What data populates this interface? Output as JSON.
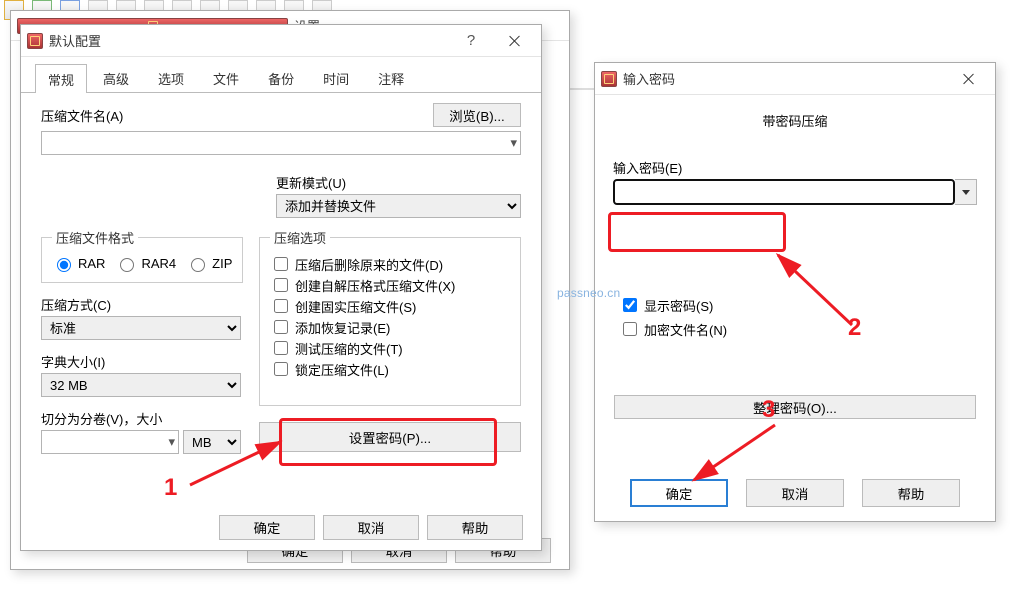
{
  "watermark": "passneo.cn",
  "parent_window": {
    "title": "设置"
  },
  "dialog1": {
    "title": "默认配置",
    "tabs": [
      "常规",
      "高级",
      "选项",
      "文件",
      "备份",
      "时间",
      "注释"
    ],
    "active_tab": 0,
    "archive_name_label": "压缩文件名(A)",
    "browse_btn": "浏览(B)...",
    "update_mode_label": "更新模式(U)",
    "update_mode_value": "添加并替换文件",
    "format_legend": "压缩文件格式",
    "formats": {
      "rar": "RAR",
      "rar4": "RAR4",
      "zip": "ZIP"
    },
    "method_label": "压缩方式(C)",
    "method_value": "标准",
    "dict_label": "字典大小(I)",
    "dict_value": "32 MB",
    "split_label": "切分为分卷(V)，大小",
    "split_unit": "MB",
    "options_legend": "压缩选项",
    "options": [
      "压缩后删除原来的文件(D)",
      "创建自解压格式压缩文件(X)",
      "创建固实压缩文件(S)",
      "添加恢复记录(E)",
      "测试压缩的文件(T)",
      "锁定压缩文件(L)"
    ],
    "set_password_btn": "设置密码(P)...",
    "footer": {
      "ok": "确定",
      "cancel": "取消",
      "help": "帮助"
    }
  },
  "dialog2": {
    "title": "输入密码",
    "subtitle": "带密码压缩",
    "password_label": "输入密码(E)",
    "show_password": "显示密码(S)",
    "encrypt_names": "加密文件名(N)",
    "organize_btn": "整理密码(O)...",
    "footer": {
      "ok": "确定",
      "cancel": "取消",
      "help": "帮助"
    }
  },
  "annotations": {
    "one": "1",
    "two": "2",
    "three": "3"
  }
}
